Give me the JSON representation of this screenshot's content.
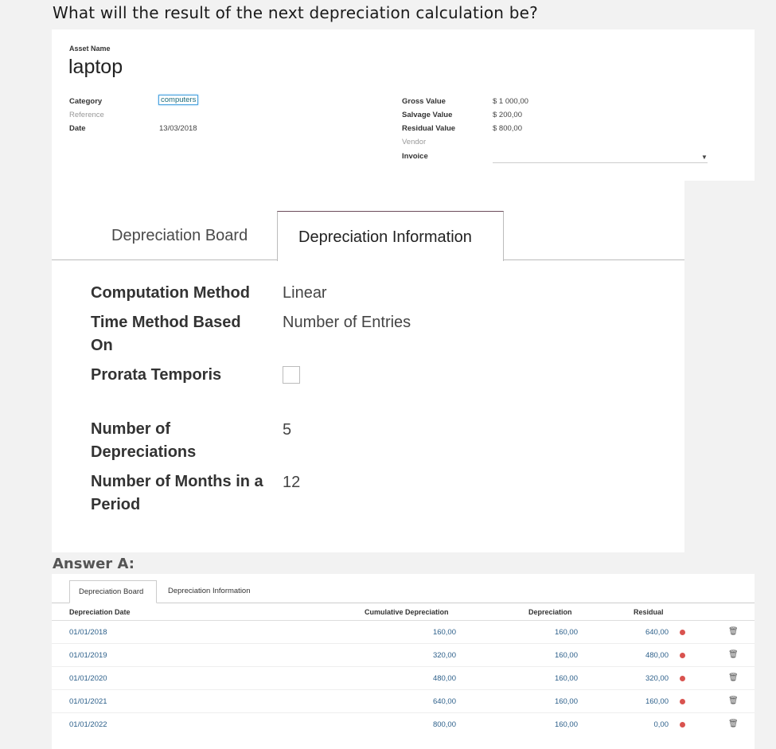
{
  "question": "What will the result of the next depreciation calculation be?",
  "form": {
    "asset_name_label": "Asset Name",
    "asset_name": "laptop",
    "category_label": "Category",
    "category_value": "computers",
    "reference_label": "Reference",
    "date_label": "Date",
    "date_value": "13/03/2018",
    "gross_label": "Gross Value",
    "gross_value": "$ 1 000,00",
    "salvage_label": "Salvage Value",
    "salvage_value": "$ 200,00",
    "residual_label": "Residual Value",
    "residual_value": "$ 800,00",
    "vendor_label": "Vendor",
    "invoice_label": "Invoice"
  },
  "tabs": {
    "board": "Depreciation Board",
    "info": "Depreciation Information"
  },
  "info": {
    "computation_method_label": "Computation Method",
    "computation_method_value": "Linear",
    "time_method_label": "Time Method Based On",
    "time_method_value": "Number of Entries",
    "prorata_label": "Prorata Temporis",
    "num_depr_label": "Number of Depreciations",
    "num_depr_value": "5",
    "months_label": "Number of Months in a Period",
    "months_value": "12"
  },
  "answer_label": "Answer A:",
  "board": {
    "tab_board": "Depreciation Board",
    "tab_info": "Depreciation Information",
    "columns": [
      "Depreciation Date",
      "Cumulative Depreciation",
      "Depreciation",
      "Residual"
    ],
    "rows": [
      {
        "date": "01/01/2018",
        "cumulative": "160,00",
        "depreciation": "160,00",
        "residual": "640,00"
      },
      {
        "date": "01/01/2019",
        "cumulative": "320,00",
        "depreciation": "160,00",
        "residual": "480,00"
      },
      {
        "date": "01/01/2020",
        "cumulative": "480,00",
        "depreciation": "160,00",
        "residual": "320,00"
      },
      {
        "date": "01/01/2021",
        "cumulative": "640,00",
        "depreciation": "160,00",
        "residual": "160,00"
      },
      {
        "date": "01/01/2022",
        "cumulative": "800,00",
        "depreciation": "160,00",
        "residual": "0,00"
      }
    ],
    "status_color": "#d9534f"
  }
}
